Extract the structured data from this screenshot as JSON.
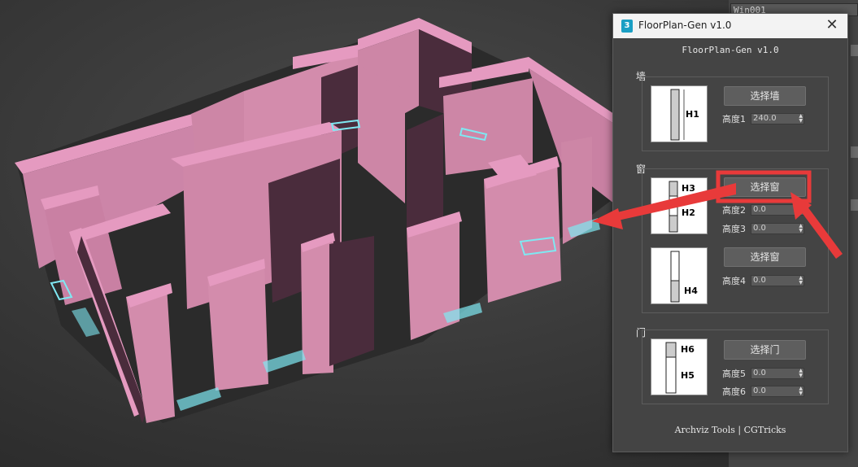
{
  "right_panel": {
    "object_name": "Win001"
  },
  "dialog": {
    "title": "FloorPlan-Gen v1.0",
    "app_icon_text": "3",
    "close_symbol": "✕",
    "heading": "FloorPlan-Gen v1.0",
    "footer": "Archviz Tools | CGTricks",
    "wall": {
      "label": "墙",
      "thumb_label": "H1",
      "button": "选择墙",
      "fields": [
        {
          "label": "高度1",
          "value": "240.0"
        }
      ]
    },
    "window": {
      "label": "窗",
      "thumb1_labels": [
        "H3",
        "H2"
      ],
      "button1": "选择窗",
      "fields1": [
        {
          "label": "高度2",
          "value": "0.0"
        },
        {
          "label": "高度3",
          "value": "0.0"
        }
      ],
      "thumb2_label": "H4",
      "button2": "选择窗",
      "fields2": [
        {
          "label": "高度4",
          "value": "0.0"
        }
      ]
    },
    "door": {
      "label": "门",
      "thumb_labels": [
        "H6",
        "H5"
      ],
      "button": "选择门",
      "fields": [
        {
          "label": "高度5",
          "value": "0.0"
        },
        {
          "label": "高度6",
          "value": "0.0"
        }
      ]
    }
  },
  "colors": {
    "viewport_bg": "#3a3a3a",
    "wall_top": "#e08cb0",
    "wall_face": "#cd86a6",
    "wall_shadow": "#4b2d3c",
    "window_highlight": "#7fe8f2",
    "annotation_red": "#e83a3a",
    "dialog_bg": "#444444"
  },
  "icons": {
    "spinner": "up-down-arrows",
    "app": "3ds-max-icon",
    "close": "close-icon"
  }
}
